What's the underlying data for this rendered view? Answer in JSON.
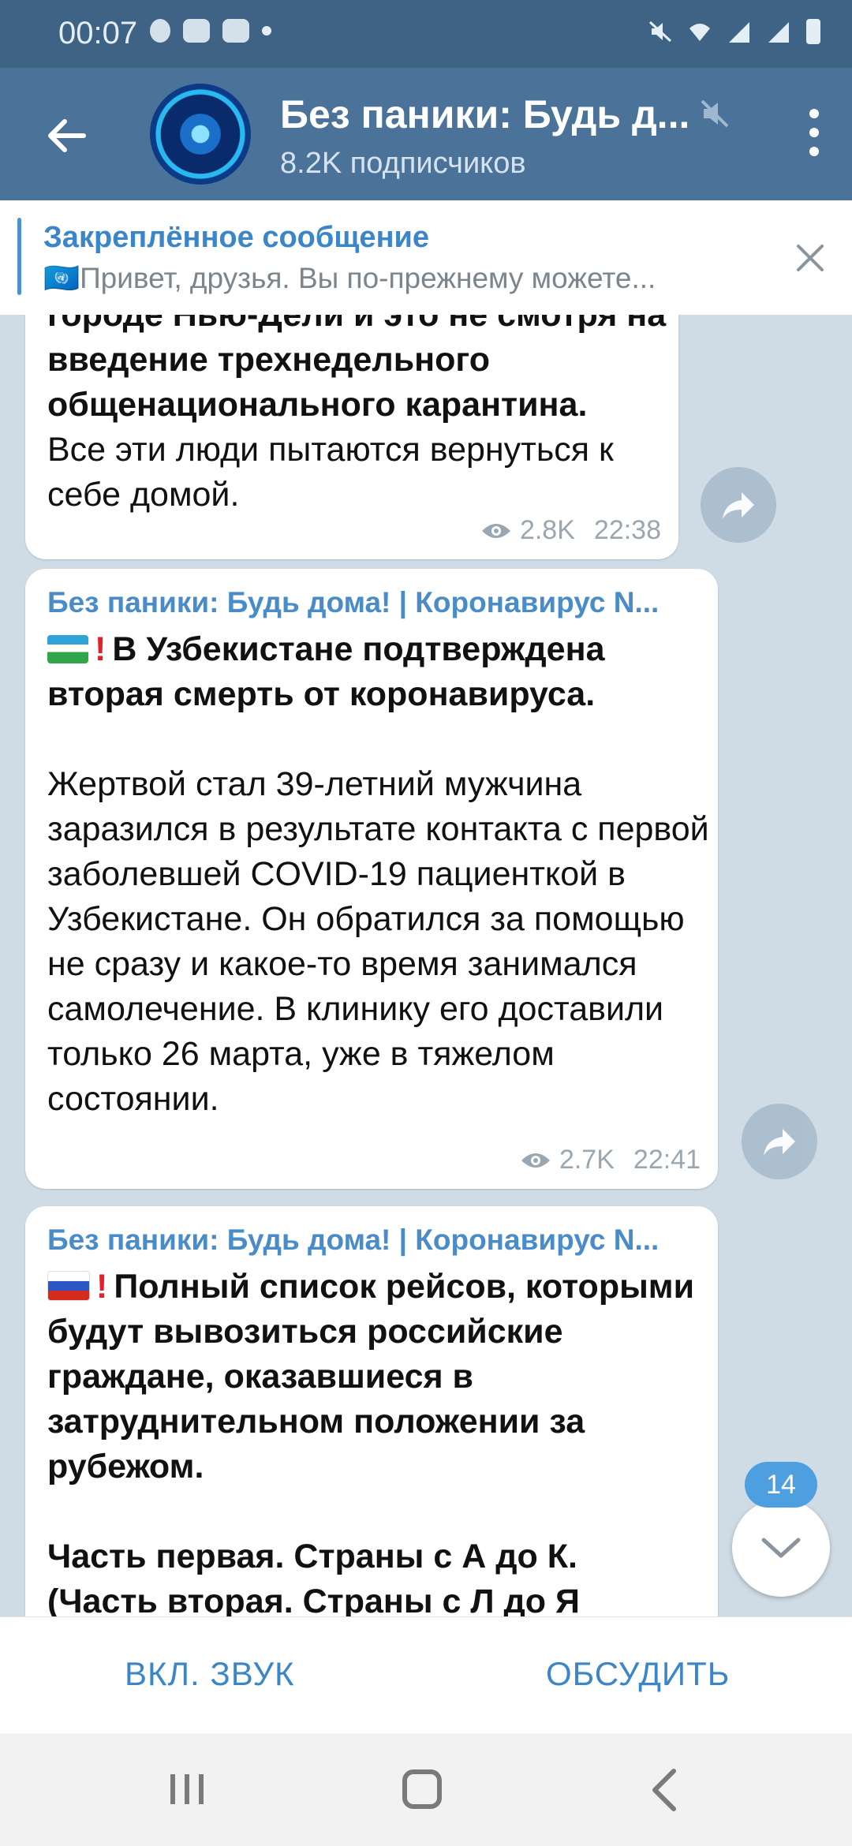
{
  "status_bar": {
    "time": "00:07"
  },
  "header": {
    "title": "Без паники: Будь д...",
    "subtitle": "8.2K подписчиков"
  },
  "pinned": {
    "title": "Закреплённое сообщение",
    "text": "🇺🇳Привет, друзья. Вы по-прежнему можете..."
  },
  "messages": [
    {
      "bold_lines": "городе Нью-Дели и это не смотря на введение трехнедельного общенационального карантина.",
      "text": "Все эти люди пытаются вернуться к себе домой.",
      "views": "2.8K",
      "time": "22:38"
    },
    {
      "author": "Без паники: Будь дома! | Коронавирус N...",
      "headline": "В Узбекистане подтверждена вторая смерть от коронавируса.",
      "text": "Жертвой стал 39-летний мужчина заразился в результате контакта с первой заболевшей COVID-19 пациенткой в Узбекистане. Он обратился за помощью не сразу и какое-то время занимался самолечение. В клинику его доставили только 26 марта, уже в тяжелом состоянии.",
      "views": "2.7K",
      "time": "22:41"
    },
    {
      "author": "Без паники: Будь дома! | Коронавирус N...",
      "headline": "Полный список рейсов, которыми будут вывозиться российские граждане, оказавшиеся в затруднительном положении за рубежом.",
      "part": "Часть первая. Страны с А до К.",
      "part2": "(Часть вторая. Страны с Л до Я"
    }
  ],
  "unread_badge": "14",
  "bottom_bar": {
    "mute_label": "ВКЛ. ЗВУК",
    "discuss_label": "ОБСУДИТЬ"
  },
  "colors": {
    "header": "#4b7399",
    "statusbar": "#3f6385",
    "accent": "#3a86c8",
    "chat_bg": "#cfdbe5"
  },
  "icons": [
    "back-arrow-icon",
    "mute-icon",
    "kebab-menu-icon",
    "close-icon",
    "share-icon",
    "eye-icon",
    "chevron-down-icon"
  ]
}
